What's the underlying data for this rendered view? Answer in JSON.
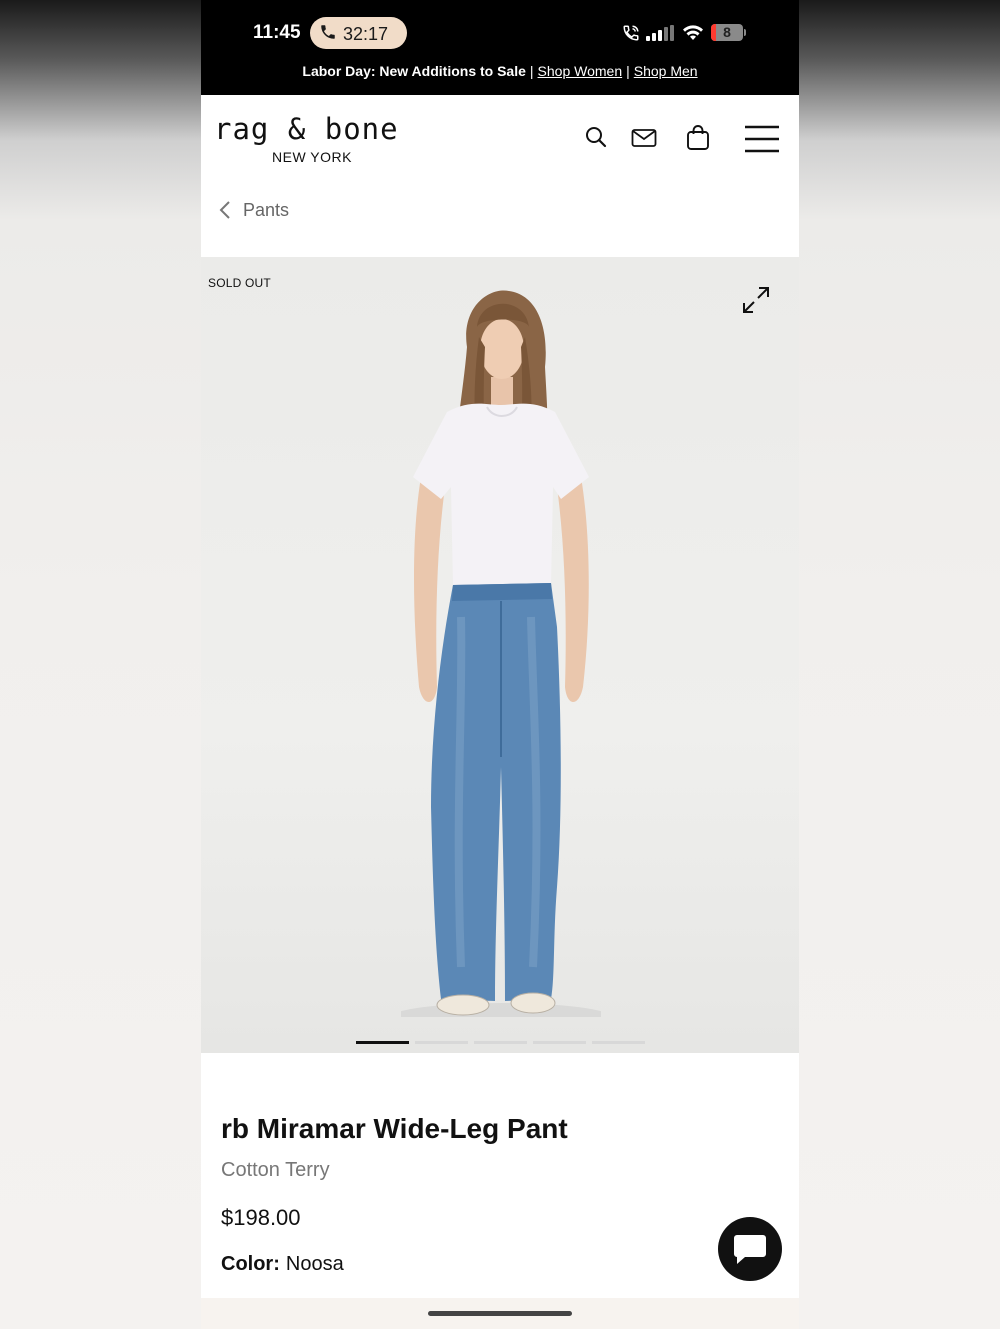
{
  "status_bar": {
    "time": "11:45",
    "call_duration": "32:17",
    "battery": "8",
    "icons": [
      "phone-icon",
      "wifi-calling-icon",
      "signal-icon",
      "wifi-icon",
      "battery-icon"
    ]
  },
  "promo": {
    "text": "Labor Day: New Additions to Sale",
    "separator": "|",
    "link_women": "Shop Women",
    "link_men": "Shop Men"
  },
  "header": {
    "logo_main": "rag & bone",
    "logo_sub": "NEW YORK",
    "icons": [
      "search-icon",
      "mail-icon",
      "bag-icon",
      "menu-icon"
    ]
  },
  "breadcrumb": {
    "label": "Pants"
  },
  "gallery": {
    "badge": "SOLD OUT",
    "slide_count": 5,
    "active_slide": 1
  },
  "product": {
    "name": "rb Miramar Wide-Leg Pant",
    "material": "Cotton Terry",
    "price": "$198.00",
    "color_label": "Color:",
    "color_value": "Noosa"
  },
  "colors": {
    "banner_bg": "#000000",
    "call_pill": "#f1dcc8",
    "battery_low": "#ff3b30",
    "text_primary": "#111111",
    "text_muted": "#777777"
  }
}
